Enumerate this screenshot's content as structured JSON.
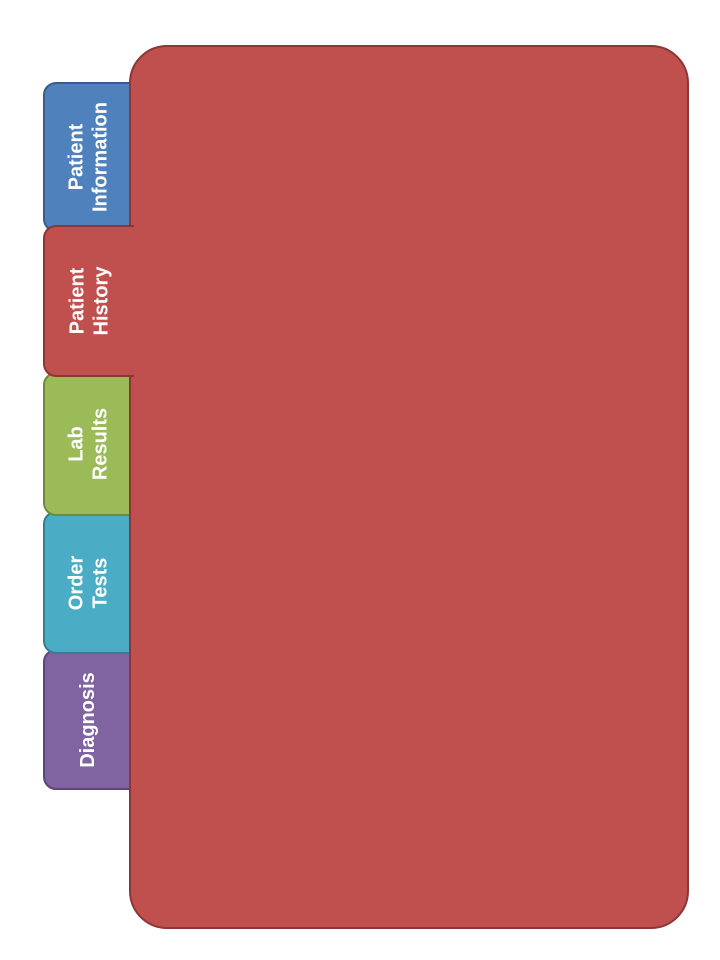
{
  "tabs": [
    {
      "id": "patient-information",
      "label": "Patient\nInformation",
      "color": "#4f81bd",
      "border": "#385d8a",
      "active": false
    },
    {
      "id": "patient-history",
      "label": "Patient\nHistory",
      "color": "#c0504d",
      "border": "#8c3636",
      "active": true
    },
    {
      "id": "lab-results",
      "label": "Lab\nResults",
      "color": "#9bbb59",
      "border": "#71893f",
      "active": false
    },
    {
      "id": "order-tests",
      "label": "Order\nTests",
      "color": "#4bacc6",
      "border": "#357d91",
      "active": false
    },
    {
      "id": "diagnosis",
      "label": "Diagnosis",
      "color": "#8064a2",
      "border": "#5c4776",
      "active": false
    }
  ],
  "panel": {
    "color": "#c0504d"
  }
}
